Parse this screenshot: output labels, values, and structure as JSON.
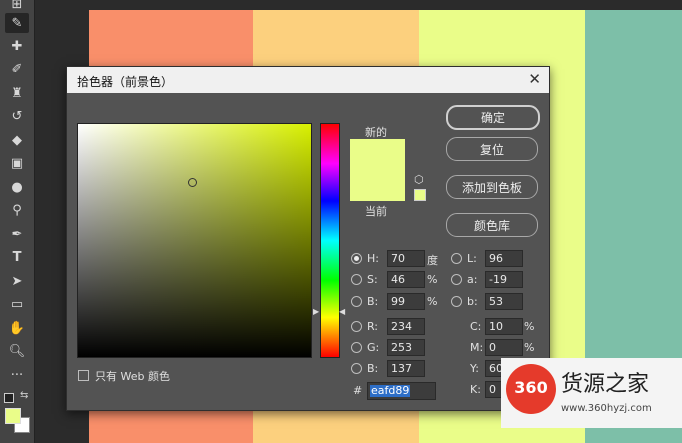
{
  "dialog": {
    "title": "拾色器（前景色）",
    "new_label": "新的",
    "current_label": "当前",
    "buttons": {
      "ok": "确定",
      "reset": "复位",
      "add_to_swatches": "添加到色板",
      "color_libraries": "颜色库"
    },
    "hsb": {
      "h": {
        "label": "H:",
        "value": "70",
        "unit": "度"
      },
      "s": {
        "label": "S:",
        "value": "46",
        "unit": "%"
      },
      "b": {
        "label": "B:",
        "value": "99",
        "unit": "%"
      }
    },
    "rgb": {
      "r": {
        "label": "R:",
        "value": "234"
      },
      "g": {
        "label": "G:",
        "value": "253"
      },
      "b": {
        "label": "B:",
        "value": "137"
      }
    },
    "lab": {
      "l": {
        "label": "L:",
        "value": "96"
      },
      "a": {
        "label": "a:",
        "value": "-19"
      },
      "b": {
        "label": "b:",
        "value": "53"
      }
    },
    "cmyk": {
      "c": {
        "label": "C:",
        "value": "10",
        "unit": "%"
      },
      "m": {
        "label": "M:",
        "value": "0",
        "unit": "%"
      },
      "y": {
        "label": "Y:",
        "value": "60"
      },
      "k": {
        "label": "K:",
        "value": "0"
      }
    },
    "hex_label": "#",
    "hex_value": "eafd89",
    "web_only_label": "只有 Web 颜色",
    "selected_color": "#eafd89"
  },
  "canvas_colors": [
    "#f98f6a",
    "#fcd07e",
    "#eafd89",
    "#7dbfa8"
  ],
  "watermark": {
    "number": "360",
    "name": "货源之家",
    "url": "www.360hyzj.com"
  },
  "icons": [
    "move-icon",
    "eyedropper-icon",
    "healing-brush-icon",
    "brush-icon",
    "stamp-icon",
    "history-brush-icon",
    "eraser-icon",
    "gradient-icon",
    "blur-icon",
    "dodge-icon",
    "pen-icon",
    "type-icon",
    "path-select-icon",
    "rectangle-icon",
    "hand-icon",
    "zoom-icon",
    "more-icon"
  ]
}
